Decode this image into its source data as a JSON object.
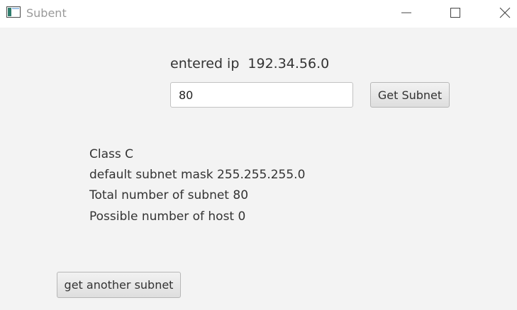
{
  "window": {
    "title": "Subent",
    "icon": "app-window-icon"
  },
  "titlebar_buttons": {
    "minimize_icon": "minimize-icon",
    "maximize_icon": "maximize-icon",
    "close_icon": "close-icon"
  },
  "form": {
    "ip_label": "entered ip",
    "ip_value": "192.34.56.0",
    "input_value": "80",
    "get_subnet_label": "Get Subnet"
  },
  "results": {
    "class_line": "Class C",
    "mask_line": "default subnet mask 255.255.255.0",
    "subnets_line": "Total number of subnet 80",
    "hosts_line": "Possible number of host 0"
  },
  "footer": {
    "another_label": "get another subnet"
  }
}
